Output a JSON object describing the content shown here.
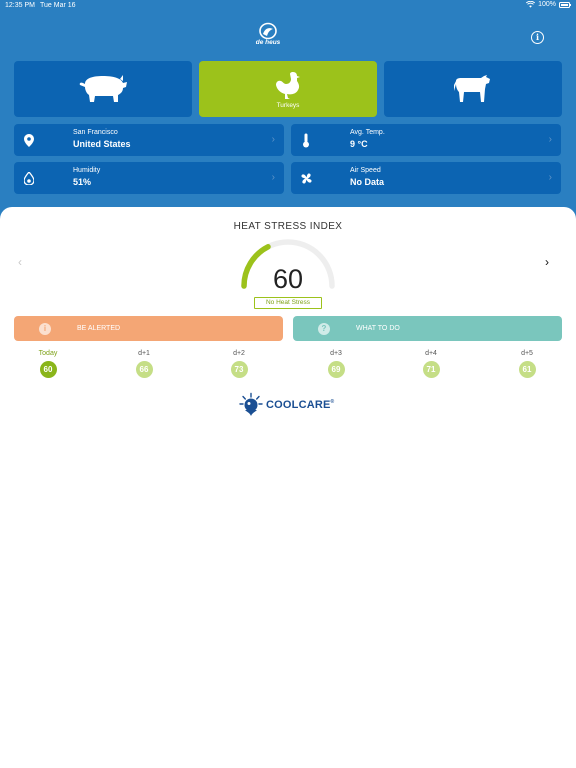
{
  "status_bar": {
    "time": "12:35 PM",
    "date": "Tue Mar 16",
    "battery": "100%"
  },
  "brand": {
    "name": "de heus"
  },
  "animals": [
    {
      "name": "Pigs",
      "icon": "pig-icon",
      "label": "",
      "active": false
    },
    {
      "name": "Turkeys",
      "icon": "turkey-icon",
      "label": "Turkeys",
      "active": true
    },
    {
      "name": "Cows",
      "icon": "cow-icon",
      "label": "",
      "active": false
    }
  ],
  "location": {
    "city": "San Francisco",
    "country": "United States",
    "icon": "location-pin-icon"
  },
  "temperature": {
    "label": "Avg. Temp.",
    "value": "9 °C",
    "icon": "thermometer-icon"
  },
  "humidity": {
    "label": "Humidity",
    "value": "51%",
    "icon": "droplet-icon"
  },
  "air_speed": {
    "label": "Air Speed",
    "value": "No Data",
    "icon": "fan-icon"
  },
  "heat_stress": {
    "title": "HEAT STRESS INDEX",
    "value": "60",
    "status": "No Heat Stress",
    "level": 0.35
  },
  "actions": {
    "alert_label": "BE ALERTED",
    "todo_label": "WHAT TO DO"
  },
  "forecast": [
    {
      "day": "Today",
      "value": "60"
    },
    {
      "day": "d+1",
      "value": "66"
    },
    {
      "day": "d+2",
      "value": "73"
    },
    {
      "day": "d+3",
      "value": "69"
    },
    {
      "day": "d+4",
      "value": "71"
    },
    {
      "day": "d+5",
      "value": "61"
    }
  ],
  "footer": {
    "brand": "COOLCARE"
  },
  "colors": {
    "header_blue": "#2a7fc1",
    "tile_blue": "#0c64b2",
    "active_green": "#9cc21b",
    "alert_orange": "#f4a675",
    "todo_teal": "#7ac6bd",
    "forecast_today": "#8ab51a",
    "forecast_other": "#c5de86",
    "coolcare_blue": "#1b4f93"
  }
}
